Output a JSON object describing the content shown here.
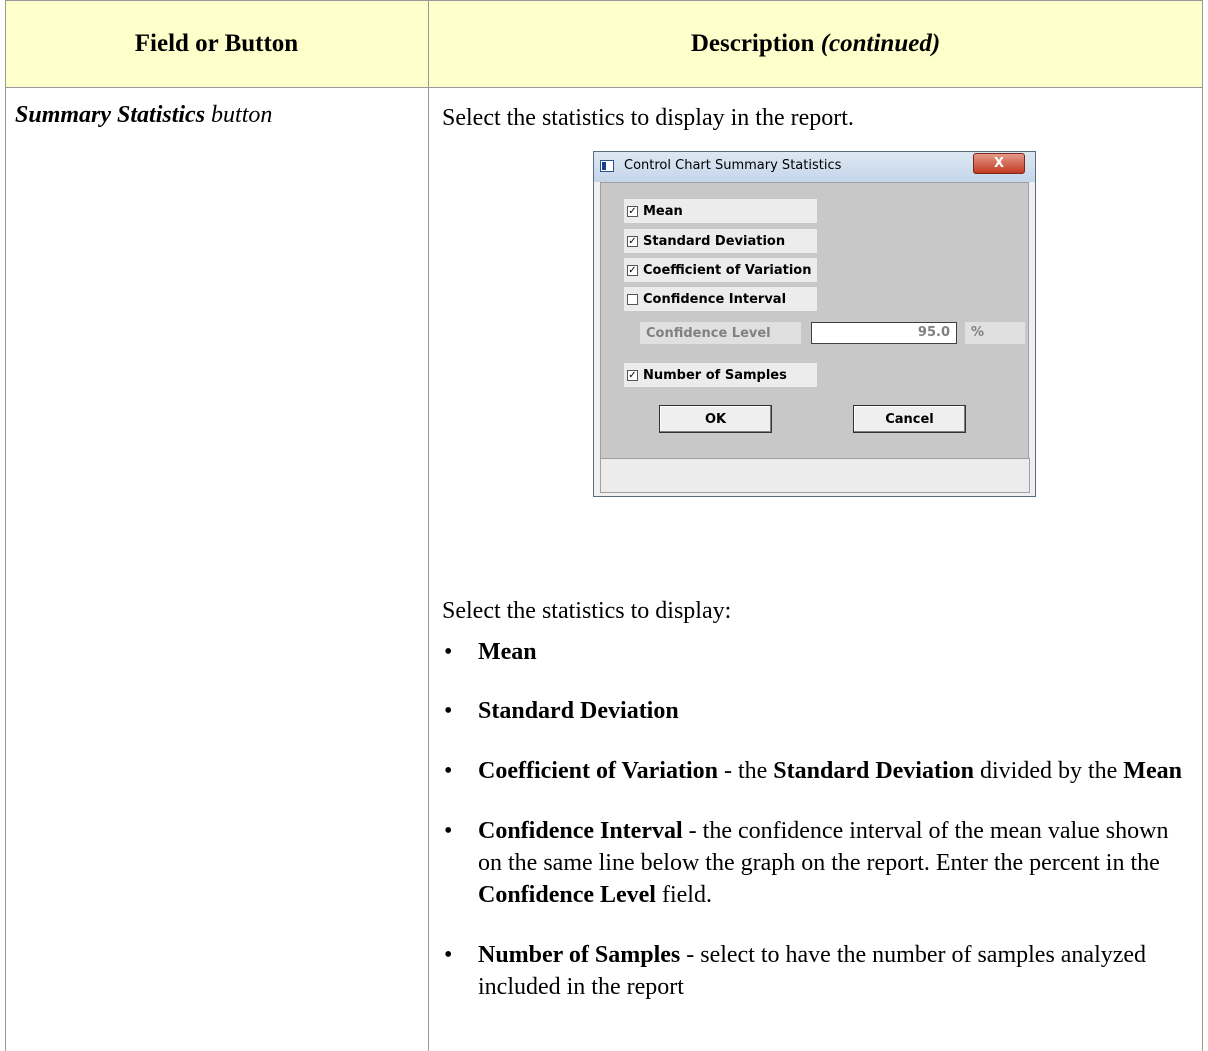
{
  "table": {
    "header_left": "Field or Button",
    "header_right_prefix": "Description",
    "header_right_suffix": "(continued)"
  },
  "row": {
    "field_bold": "Summary Statistics",
    "field_rest": "button",
    "intro": "Select the statistics to display in the report.",
    "intro2": "Select the statistics to display:"
  },
  "dialog": {
    "title": "Control Chart Summary Statistics",
    "close": "X",
    "checkboxes": [
      {
        "label": "Mean",
        "checked": true
      },
      {
        "label": "Standard Deviation",
        "checked": true
      },
      {
        "label": "Coefficient of Variation",
        "checked": true
      },
      {
        "label": "Confidence Interval",
        "checked": false
      },
      {
        "label": "Number of Samples",
        "checked": true
      }
    ],
    "confidence_level_label": "Confidence Level",
    "confidence_level_value": "95.0",
    "confidence_level_unit": "%",
    "ok_label": "OK",
    "cancel_label": "Cancel"
  },
  "bullets": [
    {
      "bold": "Mean",
      "text": ""
    },
    {
      "bold": "Standard Deviation",
      "text": ""
    },
    {
      "bold": "Coefficient of Variation",
      "text": " - the ",
      "bold2": "Standard Deviation",
      "text2": " divided by the ",
      "bold3": "Mean",
      "text3": ""
    },
    {
      "bold": "Confidence Interval",
      "text": " - the confidence interval of the mean value shown on the same line below the graph on the report. Enter the percent in the ",
      "bold2": "Confidence Level",
      "text2": " field."
    },
    {
      "bold": "Number of Samples",
      "text": " - select to have the number of samples analyzed included in the report"
    }
  ]
}
